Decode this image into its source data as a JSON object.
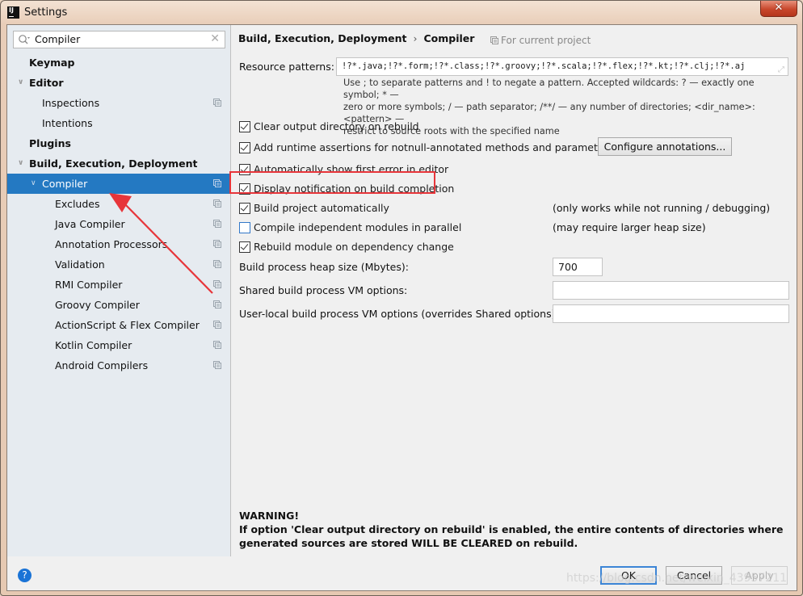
{
  "window": {
    "title": "Settings",
    "app_icon_text": "IJ",
    "close_glyph": "✕"
  },
  "sidebar": {
    "search": {
      "value": "Compiler",
      "clear_glyph": "✕"
    },
    "items": [
      {
        "label": "Keymap",
        "bold": true,
        "level": 0,
        "arrow": "",
        "project_icon": false
      },
      {
        "label": "Editor",
        "bold": true,
        "level": 0,
        "arrow": "∨",
        "project_icon": false
      },
      {
        "label": "Inspections",
        "bold": false,
        "level": 1,
        "arrow": "",
        "project_icon": true
      },
      {
        "label": "Intentions",
        "bold": false,
        "level": 1,
        "arrow": "",
        "project_icon": false
      },
      {
        "label": "Plugins",
        "bold": true,
        "level": 0,
        "arrow": "",
        "project_icon": false
      },
      {
        "label": "Build, Execution, Deployment",
        "bold": true,
        "level": 0,
        "arrow": "∨",
        "project_icon": false
      },
      {
        "label": "Compiler",
        "bold": false,
        "level": 1,
        "arrow": "∨",
        "project_icon": true,
        "selected": true
      },
      {
        "label": "Excludes",
        "bold": false,
        "level": 2,
        "arrow": "",
        "project_icon": true
      },
      {
        "label": "Java Compiler",
        "bold": false,
        "level": 2,
        "arrow": "",
        "project_icon": true
      },
      {
        "label": "Annotation Processors",
        "bold": false,
        "level": 2,
        "arrow": "",
        "project_icon": true
      },
      {
        "label": "Validation",
        "bold": false,
        "level": 2,
        "arrow": "",
        "project_icon": true
      },
      {
        "label": "RMI Compiler",
        "bold": false,
        "level": 2,
        "arrow": "",
        "project_icon": true
      },
      {
        "label": "Groovy Compiler",
        "bold": false,
        "level": 2,
        "arrow": "",
        "project_icon": true
      },
      {
        "label": "ActionScript & Flex Compiler",
        "bold": false,
        "level": 2,
        "arrow": "",
        "project_icon": true
      },
      {
        "label": "Kotlin Compiler",
        "bold": false,
        "level": 2,
        "arrow": "",
        "project_icon": true
      },
      {
        "label": "Android Compilers",
        "bold": false,
        "level": 2,
        "arrow": "",
        "project_icon": true
      }
    ]
  },
  "main": {
    "breadcrumb": {
      "parent": "Build, Execution, Deployment",
      "separator": "›",
      "current": "Compiler"
    },
    "for_current_project": "For current project",
    "resource_patterns": {
      "label": "Resource patterns:",
      "value": "!?*.java;!?*.form;!?*.class;!?*.groovy;!?*.scala;!?*.flex;!?*.kt;!?*.clj;!?*.aj"
    },
    "hint_lines": [
      "Use ; to separate patterns and ! to negate a pattern. Accepted wildcards: ? — exactly one symbol; * —",
      "zero or more symbols; / — path separator; /**/ — any number of directories; <dir_name>:<pattern> —",
      "restrict to source roots with the specified name"
    ],
    "options": [
      {
        "label": "Clear output directory on rebuild",
        "checked": true,
        "note": ""
      },
      {
        "label": "Add runtime assertions for notnull-annotated methods and parameters",
        "checked": true,
        "note": ""
      },
      {
        "label": "Automatically show first error in editor",
        "checked": true,
        "note": ""
      },
      {
        "label": "Display notification on build completion",
        "checked": true,
        "note": ""
      },
      {
        "label": "Build project automatically",
        "checked": true,
        "note": "(only works while not running / debugging)"
      },
      {
        "label": "Compile independent modules in parallel",
        "checked": false,
        "note": "(may require larger heap size)"
      },
      {
        "label": "Rebuild module on dependency change",
        "checked": true,
        "note": ""
      }
    ],
    "configure_annotations_button": "Configure annotations...",
    "heap_size": {
      "label": "Build process heap size (Mbytes):",
      "value": "700"
    },
    "shared_vm_options": {
      "label": "Shared build process VM options:",
      "value": ""
    },
    "user_vm_options": {
      "label": "User-local build process VM options (overrides Shared options):",
      "value": ""
    },
    "warning": {
      "title": "WARNING!",
      "text": "If option 'Clear output directory on rebuild' is enabled, the entire contents of directories where generated sources are stored WILL BE CLEARED on rebuild."
    }
  },
  "footer": {
    "help_glyph": "?",
    "ok": "OK",
    "cancel": "Cancel",
    "apply": "Apply"
  },
  "annotations": {
    "highlight_color": "#e7353a",
    "arrow_color": "#e7353a"
  },
  "watermark": "https://blog.csdn.net/weixin_43957211",
  "colors": {
    "selection": "#2479c2",
    "sidebar_bg": "#e6ebf0",
    "content_bg": "#f0f0f0"
  }
}
